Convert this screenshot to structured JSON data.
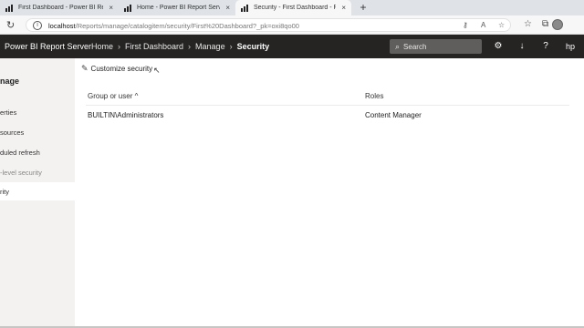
{
  "browser": {
    "tabs": [
      {
        "title": "First Dashboard - Power BI Repo",
        "close": "×"
      },
      {
        "title": "Home - Power BI Report Server",
        "close": "×"
      },
      {
        "title": "Security - First Dashboard - Pow",
        "close": "×"
      }
    ],
    "new_tab": "+",
    "url_host": "localhost",
    "url_path": "/Reports/manage/catalogitem/security/First%20Dashboard?_pk=oxi8qo00"
  },
  "header": {
    "app_name": "Power BI Report Server",
    "breadcrumbs": [
      "Home",
      "First Dashboard",
      "Manage",
      "Security"
    ],
    "search_placeholder": "Search",
    "user_initials": "hp"
  },
  "leftnav": {
    "title": "nage",
    "items": [
      {
        "label": "erties"
      },
      {
        "label": "sources"
      },
      {
        "label": "duled refresh"
      },
      {
        "label": "-level security"
      },
      {
        "label": "rity"
      }
    ]
  },
  "toolbar": {
    "customize_label": "Customize security"
  },
  "table": {
    "columns": [
      "Group or user",
      "Roles"
    ],
    "sort_indicator": "^",
    "rows": [
      {
        "group": "BUILTIN\\Administrators",
        "roles": "Content Manager"
      }
    ]
  }
}
